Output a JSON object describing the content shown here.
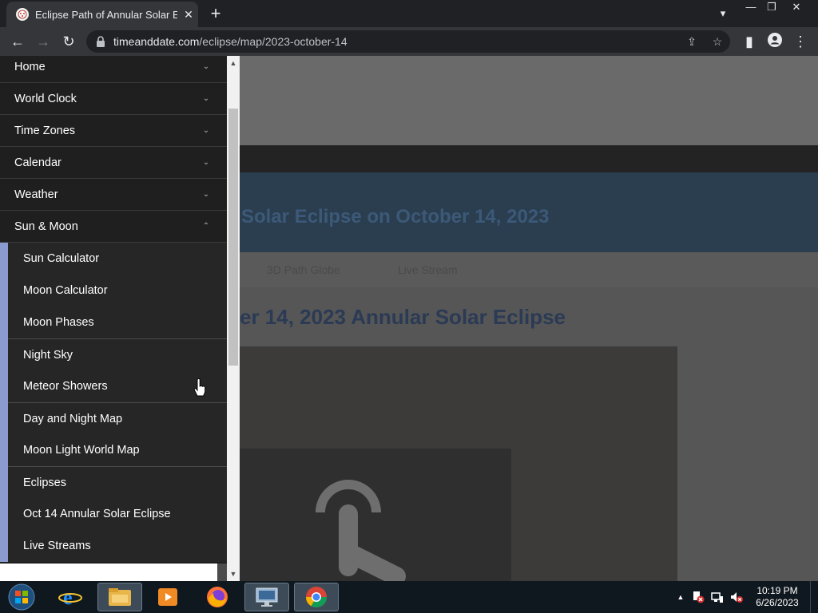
{
  "browser": {
    "tab_title": "Eclipse Path of Annular Solar Eclipse",
    "tab_close": "✕",
    "new_tab": "+",
    "url_host": "timeanddate.com",
    "url_path": "/eclipse/map/2023-october-14",
    "back": "←",
    "forward": "→",
    "reload": "↻",
    "share": "⇪",
    "bookmark": "☆",
    "sidepanel": "▮",
    "menu": "⋮",
    "window_controls": [
      "▾",
      "—",
      "❐",
      "✕"
    ]
  },
  "menu": {
    "top_items": [
      {
        "label": "Home",
        "chevron": "⌄"
      },
      {
        "label": "World Clock",
        "chevron": "⌄"
      },
      {
        "label": "Time Zones",
        "chevron": "⌄"
      },
      {
        "label": "Calendar",
        "chevron": "⌄"
      },
      {
        "label": "Weather",
        "chevron": "⌄"
      },
      {
        "label": "Sun & Moon",
        "chevron": "⌃"
      }
    ],
    "sub_items": [
      {
        "label": "Sun Calculator"
      },
      {
        "label": "Moon Calculator"
      },
      {
        "label": "Moon Phases"
      },
      {
        "label": "Night Sky"
      },
      {
        "label": "Meteor Showers"
      },
      {
        "label": "Day and Night Map"
      },
      {
        "label": "Moon Light World Map"
      },
      {
        "label": "Eclipses"
      },
      {
        "label": "Oct 14 Annular Solar Eclipse"
      },
      {
        "label": "Live Streams"
      }
    ]
  },
  "background": {
    "heading": "Solar Eclipse on October 14, 2023",
    "subheading": "er 14, 2023 Annular Solar Eclipse",
    "tab1": "3D Path Globe",
    "tab2": "Live Stream"
  },
  "taskbar": {
    "time": "10:19 PM",
    "date": "6/26/2023"
  },
  "colors": {
    "menu_bg": "#1f1f1f",
    "submenu_bg": "#262626",
    "accent": "#8a9bd0",
    "browser_dark": "#202124",
    "toolbar": "#35363a",
    "taskbar": "#10181f"
  }
}
